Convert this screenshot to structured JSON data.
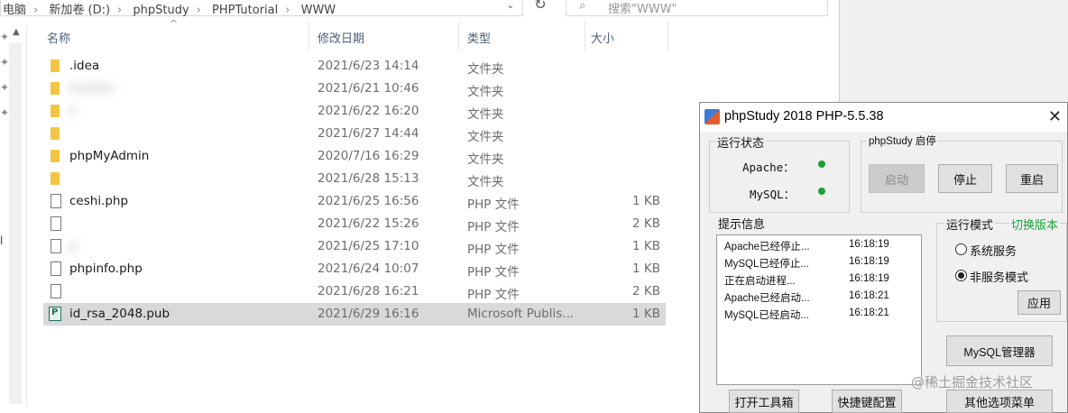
{
  "explorer": {
    "breadcrumb": [
      "电脑",
      "新加卷 (D:)",
      "phpStudy",
      "PHPTutorial",
      "WWW"
    ],
    "search_placeholder": "搜索\"WWW\"",
    "columns": {
      "name": "名称",
      "date": "修改日期",
      "type": "类型",
      "size": "大小"
    },
    "files": [
      {
        "name": ".idea",
        "date": "2021/6/23 14:14",
        "type": "文件夹",
        "size": "",
        "icon": "folder",
        "blurred": false
      },
      {
        "name": "Gordon",
        "date": "2021/6/21 10:46",
        "type": "文件夹",
        "size": "",
        "icon": "folder",
        "blurred": true
      },
      {
        "name": "ll",
        "date": "2021/6/22 16:20",
        "type": "文件夹",
        "size": "",
        "icon": "folder",
        "blurred": true
      },
      {
        "name": "",
        "date": "2021/6/27 14:44",
        "type": "文件夹",
        "size": "",
        "icon": "folder",
        "blurred": true
      },
      {
        "name": "phpMyAdmin",
        "date": "2020/7/16 16:29",
        "type": "文件夹",
        "size": "",
        "icon": "folder",
        "blurred": false
      },
      {
        "name": "",
        "date": "2021/6/28 15:13",
        "type": "文件夹",
        "size": "",
        "icon": "folder",
        "blurred": true
      },
      {
        "name": "ceshi.php",
        "date": "2021/6/25 16:56",
        "type": "PHP 文件",
        "size": "1 KB",
        "icon": "file",
        "blurred": false
      },
      {
        "name": "",
        "date": "2021/6/22 15:26",
        "type": "PHP 文件",
        "size": "2 KB",
        "icon": "file",
        "blurred": true
      },
      {
        "name": "p",
        "date": "2021/6/25 17:10",
        "type": "PHP 文件",
        "size": "1 KB",
        "icon": "file",
        "blurred": true
      },
      {
        "name": "phpinfo.php",
        "date": "2021/6/24 10:07",
        "type": "PHP 文件",
        "size": "1 KB",
        "icon": "file",
        "blurred": false
      },
      {
        "name": "",
        "date": "2021/6/28 16:21",
        "type": "PHP 文件",
        "size": "2 KB",
        "icon": "file",
        "blurred": true
      },
      {
        "name": "id_rsa_2048.pub",
        "date": "2021/6/29 16:16",
        "type": "Microsoft Publis...",
        "size": "1 KB",
        "icon": "pub",
        "blurred": false,
        "selected": true
      }
    ],
    "left_sliver_text": "l"
  },
  "phpstudy": {
    "title": "phpStudy 2018  PHP-5.5.38",
    "close": "✕",
    "status_group": "运行状态",
    "apache_label": "Apache：",
    "mysql_label": "MySQL：",
    "status_color": "#1e9e37",
    "control_group": "phpStudy 启停",
    "btn_start": "启动",
    "btn_stop": "停止",
    "btn_restart": "重启",
    "info_group": "提示信息",
    "log": [
      {
        "msg": "Apache已经停止...",
        "time": "16:18:19"
      },
      {
        "msg": "MySQL已经停止...",
        "time": "16:18:19"
      },
      {
        "msg": "正在启动进程...",
        "time": "16:18:19"
      },
      {
        "msg": "Apache已经启动...",
        "time": "16:18:21"
      },
      {
        "msg": "MySQL已经启动...",
        "time": "16:18:21"
      }
    ],
    "mode_group": "运行模式",
    "switch_version": "切换版本",
    "switch_color": "#1aa33a",
    "radio_system": "系统服务",
    "radio_nonservice": "非服务模式",
    "btn_apply": "应用",
    "btn_mysql_mgr": "MySQL管理器",
    "btn_toolbox": "打开工具箱",
    "btn_shortcut": "快捷键配置",
    "btn_other": "其他选项菜单"
  },
  "watermark": "@稀土掘金技术社区"
}
